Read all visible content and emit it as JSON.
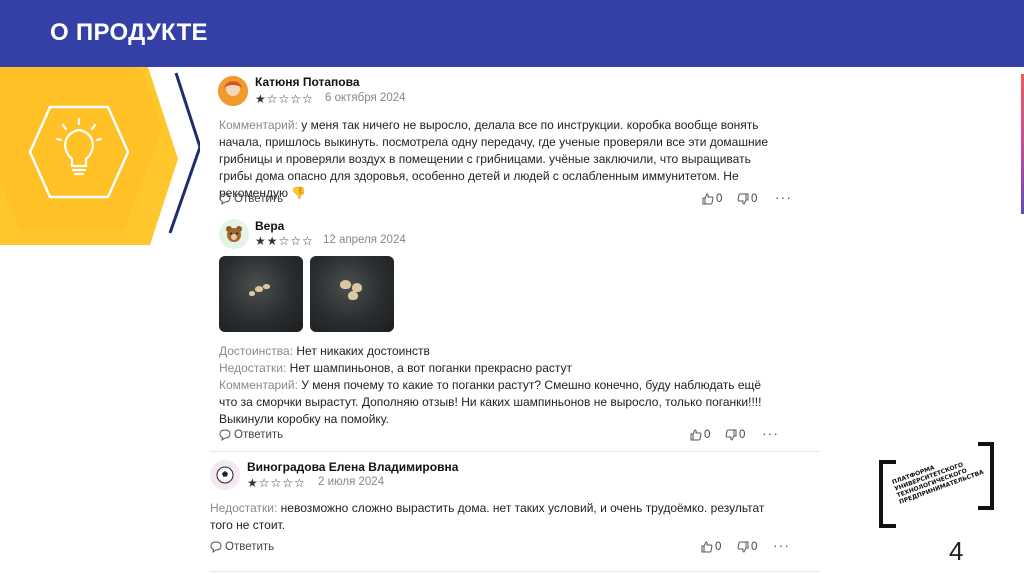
{
  "slide": {
    "title": "О ПРОДУКТЕ",
    "page_number": "4"
  },
  "logo": {
    "lines": [
      "ПЛАТФОРМА",
      "УНИВЕРСИТЕТСКОГО",
      "ТЕХНОЛОГИЧЕСКОГО",
      "ПРЕДПРИНИМАТЕЛЬСТВА"
    ]
  },
  "colors": {
    "header": "#3440a6",
    "yellow": "#ffc72c",
    "accent_navy": "#1f2c6e"
  },
  "reviews": [
    {
      "author": "Катюня Потапова",
      "stars": "★☆☆☆☆",
      "rating": 1,
      "date": "6 октября 2024",
      "comment_label": "Комментарий:",
      "comment": "у меня так ничего не выросло, делала все по инструкции. коробка вообще вонять начала, пришлось выкинуть. посмотрела одну передачу, где ученые проверяли все эти домашние грибницы и проверяли воздух в помещении с грибницами. учёные заключили, что выращивать грибы дома опасно для здоровья, особенно детей и людей с ослабленным иммунитетом. Не рекомендую 👎",
      "reply": "Ответить",
      "likes": "0",
      "dislikes": "0"
    },
    {
      "author": "Вера",
      "stars": "★★☆☆☆",
      "rating": 2,
      "date": "12 апреля 2024",
      "pros_label": "Достоинства:",
      "pros": "Нет никаких достоинств",
      "cons_label": "Недостатки:",
      "cons": "Нет шампиньонов, а вот поганки прекрасно растут",
      "comment_label": "Комментарий:",
      "comment": "У меня почему то какие то поганки растут? Смешно конечно, буду наблюдать ещё что за сморчки вырастут. Дополняю отзыв! Ни каких шампиньонов не выросло, только поганки!!!! Выкинули коробку на помойку.",
      "reply": "Ответить",
      "likes": "0",
      "dislikes": "0"
    },
    {
      "author": "Виноградова Елена Владимировна",
      "stars": "★☆☆☆☆",
      "rating": 1,
      "date": "2 июля 2024",
      "cons_label": "Недостатки:",
      "cons": "невозможно сложно вырастить дома. нет таких условий, и очень трудоёмко. результат того не стоит.",
      "reply": "Ответить",
      "likes": "0",
      "dislikes": "0"
    }
  ]
}
